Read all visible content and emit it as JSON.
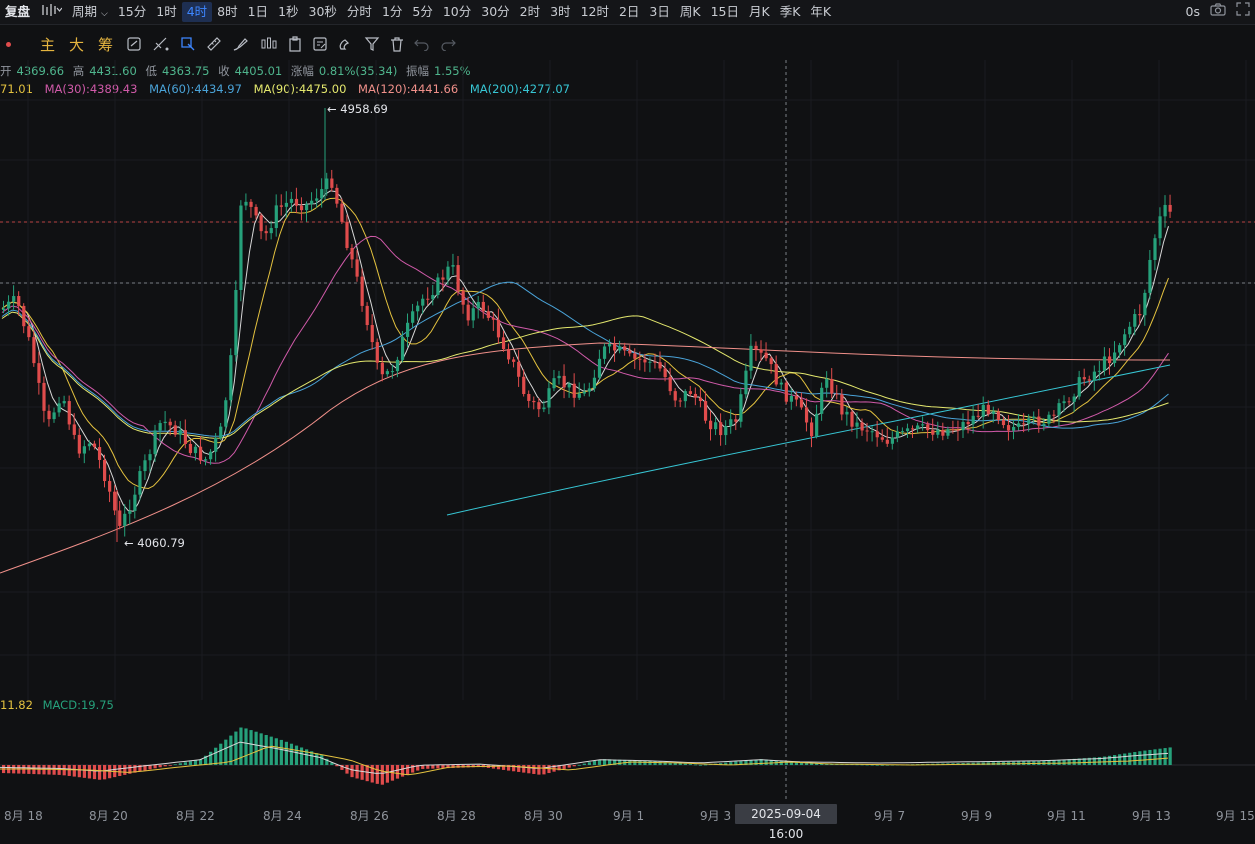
{
  "topbar": {
    "account": "复盘",
    "period_label": "周期",
    "timeframes": [
      "15分",
      "1时",
      "4时",
      "8时",
      "1日",
      "1秒",
      "30秒",
      "分时",
      "1分",
      "5分",
      "10分",
      "30分",
      "2时",
      "3时",
      "12时",
      "2日",
      "3日",
      "周K",
      "15日",
      "月K",
      "季K",
      "年K"
    ],
    "active_timeframe": "4时",
    "timer": "0s"
  },
  "toolbar": {
    "labels": [
      "主",
      "大",
      "筹"
    ],
    "icons": [
      "layer-icon",
      "pen-slash-icon",
      "marker-icon",
      "ruler-icon",
      "brush-icon",
      "candles-icon",
      "doc-icon",
      "list-edit-icon",
      "magnet-icon",
      "filter-icon",
      "trash-icon",
      "undo-icon",
      "redo-icon"
    ]
  },
  "ohlc": {
    "open_label": "开",
    "open": "4369.66",
    "high_label": "高",
    "high": "4431.60",
    "low_label": "低",
    "low": "4363.75",
    "close_label": "收",
    "close": "4405.01",
    "change_label": "涨幅",
    "change": "0.81%(35.34)",
    "amp_label": "振幅",
    "amp": "1.55%"
  },
  "ma": [
    {
      "text": "71.01",
      "color": "#e4c23f"
    },
    {
      "text": "MA(30):4389.43",
      "color": "#d05aa9"
    },
    {
      "text": "MA(60):4434.97",
      "color": "#4aa3d8"
    },
    {
      "text": "MA(90):4475.00",
      "color": "#e4e86e"
    },
    {
      "text": "MA(120):4441.66",
      "color": "#f0908a"
    },
    {
      "text": "MA(200):4277.07",
      "color": "#37c6d4"
    }
  ],
  "annotations": {
    "high": "4958.69",
    "low": "4060.79"
  },
  "macd": {
    "left_value": "11.82",
    "text": "MACD:19.75"
  },
  "x_axis": {
    "labels": [
      "8月 18",
      "8月 20",
      "8月 22",
      "8月 24",
      "8月 26",
      "8月 28",
      "8月 30",
      "9月 1",
      "9月 3",
      "9月 7",
      "9月 9",
      "9月 11",
      "9月 13",
      "9月 15"
    ],
    "crosshair_label": "2025-09-04 16:00"
  },
  "colors": {
    "up": "#26a17b",
    "down": "#e04c4c",
    "background": "#101113",
    "accent": "#3d86ff"
  }
}
